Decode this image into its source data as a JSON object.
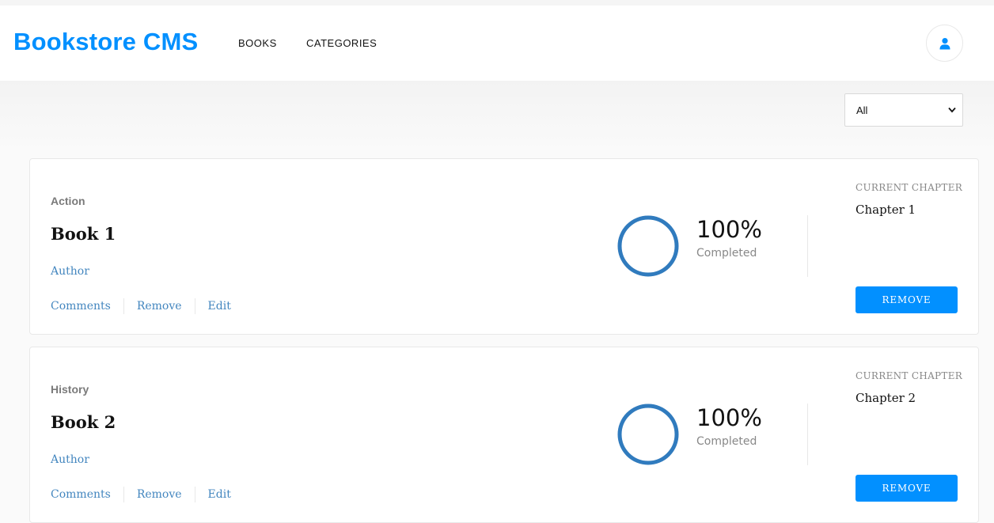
{
  "header": {
    "logo": "Bookstore CMS",
    "nav": [
      {
        "label": "BOOKS"
      },
      {
        "label": "CATEGORIES"
      }
    ],
    "user_icon": "user-icon"
  },
  "filter": {
    "selected": "All"
  },
  "books": [
    {
      "category": "Action",
      "title": "Book 1",
      "author": "Author",
      "actions": [
        "Comments",
        "Remove",
        "Edit"
      ],
      "progress_percent": 100,
      "percent_label": "100%",
      "completed_label": "Completed",
      "chapter_label": "CURRENT CHAPTER",
      "chapter": "Chapter 1",
      "remove_label": "REMOVE"
    },
    {
      "category": "History",
      "title": "Book 2",
      "author": "Author",
      "actions": [
        "Comments",
        "Remove",
        "Edit"
      ],
      "progress_percent": 100,
      "percent_label": "100%",
      "completed_label": "Completed",
      "chapter_label": "CURRENT CHAPTER",
      "chapter": "Chapter 2",
      "remove_label": "REMOVE"
    }
  ],
  "colors": {
    "accent": "#0290ff",
    "link": "#4386bf",
    "progress": "#307bbe"
  }
}
